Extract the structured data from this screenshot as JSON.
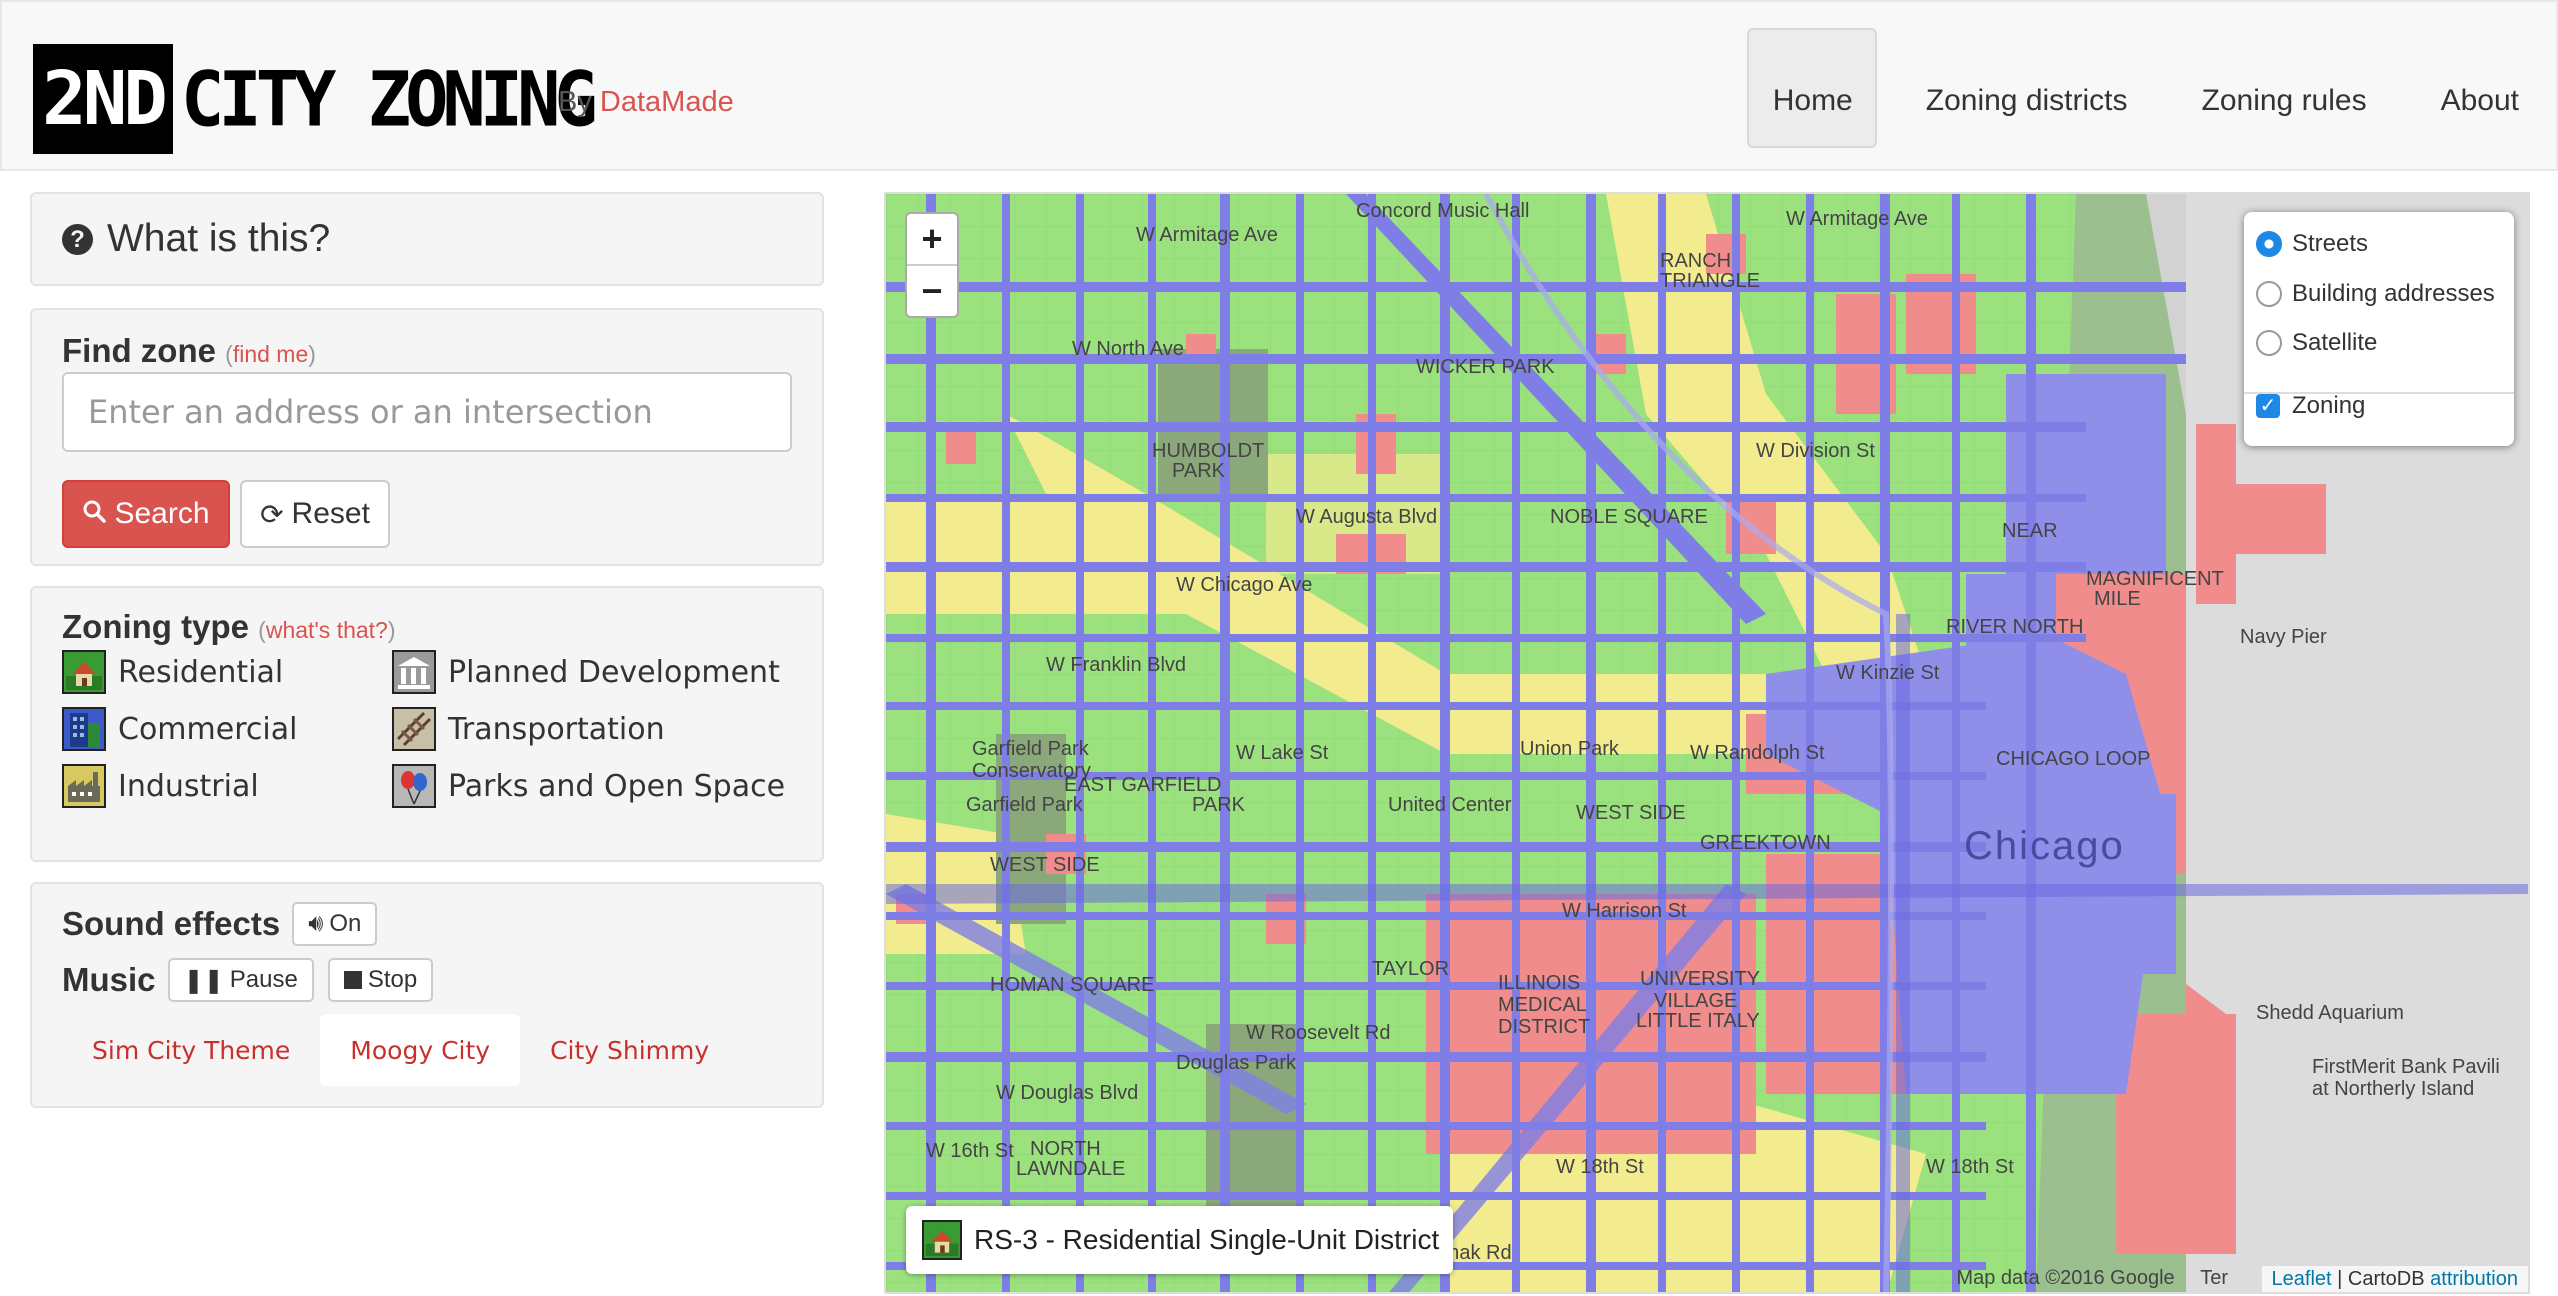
{
  "header": {
    "logo_box": "2ND",
    "logo_text": "CITY ZONING",
    "byline_prefix": "By ",
    "byline_brand": "DataMade",
    "nav": [
      {
        "label": "Home",
        "active": true
      },
      {
        "label": "Zoning districts",
        "active": false
      },
      {
        "label": "Zoning rules",
        "active": false
      },
      {
        "label": "About",
        "active": false
      }
    ]
  },
  "what": {
    "title": "What is this?",
    "icon": "question-circle-icon"
  },
  "find": {
    "heading": "Find zone",
    "find_me": "find me",
    "placeholder": "Enter an address or an intersection",
    "search_label": "Search",
    "reset_label": "Reset"
  },
  "zoning": {
    "heading": "Zoning type",
    "whats_that": "what's that?",
    "types": [
      {
        "label": "Residential",
        "icon": "house-icon",
        "color": "#3a9a33"
      },
      {
        "label": "Planned Development",
        "icon": "columns-icon",
        "color": "#8a8a8a"
      },
      {
        "label": "Commercial",
        "icon": "office-building-icon",
        "color": "#2244aa"
      },
      {
        "label": "Transportation",
        "icon": "railroad-icon",
        "color": "#6b5a4a"
      },
      {
        "label": "Industrial",
        "icon": "factory-icon",
        "color": "#b8a840"
      },
      {
        "label": "Parks and Open Space",
        "icon": "balloons-icon",
        "color": "#8a8a8a"
      }
    ]
  },
  "sound": {
    "label": "Sound effects",
    "on_label": "On",
    "music_label": "Music",
    "pause_label": "Pause",
    "stop_label": "Stop",
    "tracks": [
      {
        "label": "Sim City Theme",
        "active": false
      },
      {
        "label": "Moogy City",
        "active": true
      },
      {
        "label": "City Shimmy",
        "active": false
      }
    ]
  },
  "map": {
    "zoom_in": "+",
    "zoom_out": "−",
    "layers": {
      "streets": "Streets",
      "building_addresses": "Building addresses",
      "satellite": "Satellite",
      "zoning": "Zoning"
    },
    "info_label": "RS-3 - Residential Single-Unit District",
    "map_data": "Map data ©2016 Google",
    "terms": "Ter",
    "attribution_leaflet": "Leaflet",
    "attribution_sep": " | CartoDB ",
    "attribution_link": "attribution",
    "labels": {
      "chicago": "Chicago",
      "concord": "Concord Music Hall",
      "armitage": "W Armitage Ave",
      "armitage2": "W Armitage Ave",
      "north_ave": "W North Ave",
      "division": "W Division St",
      "augusta": "W Augusta Blvd",
      "chicago_ave": "W Chicago Ave",
      "franklin": "W Franklin Blvd",
      "lake": "W Lake St",
      "randolph": "W Randolph St",
      "kinzie": "W Kinzie St",
      "harrison": "W Harrison St",
      "roosevelt": "W Roosevelt Rd",
      "douglas_blvd": "W Douglas Blvd",
      "sixteenth": "W 16th St",
      "eighteenth": "W 18th St",
      "eighteenth2": "W 18th St",
      "cermak": "W Cermak Rd",
      "navy_pier": "Navy Pier",
      "shedd": "Shedd Aquarium",
      "firstmerit": "FirstMerit Bank Pavili",
      "northerly": "at Northerly Island",
      "garfield_cons": "Garfield Park",
      "conservatory": "Conservatory",
      "garfield_park": "Garfield Park",
      "united_center": "United Center",
      "union_park": "Union Park",
      "douglas_park": "Douglas Park",
      "humboldt": "HUMBOLDT",
      "park": "PARK",
      "wicker": "WICKER PARK",
      "ranch": "RANCH",
      "triangle": "TRIANGLE",
      "river_north": "RIVER NORTH",
      "magnificent": "MAGNIFICENT",
      "mile": "MILE",
      "chicago_loop": "CHICAGO LOOP",
      "greektown": "GREEKTOWN",
      "east_garfield": "EAST GARFIELD",
      "park2": "PARK",
      "west_side": "WEST SIDE",
      "homan": "HOMAN SQUARE",
      "taylor": "TAYLOR",
      "illinois": "ILLINOIS",
      "medical": "MEDICAL",
      "district": "DISTRICT",
      "university": "UNIVERSITY",
      "village": "VILLAGE",
      "little_italy": "LITTLE ITALY",
      "north_lawndale": "NORTH",
      "lawndale": "LAWNDALE",
      "near": "NEAR",
      "west_side2": "WEST SIDE",
      "noble": "NOBLE SQUARE"
    }
  }
}
